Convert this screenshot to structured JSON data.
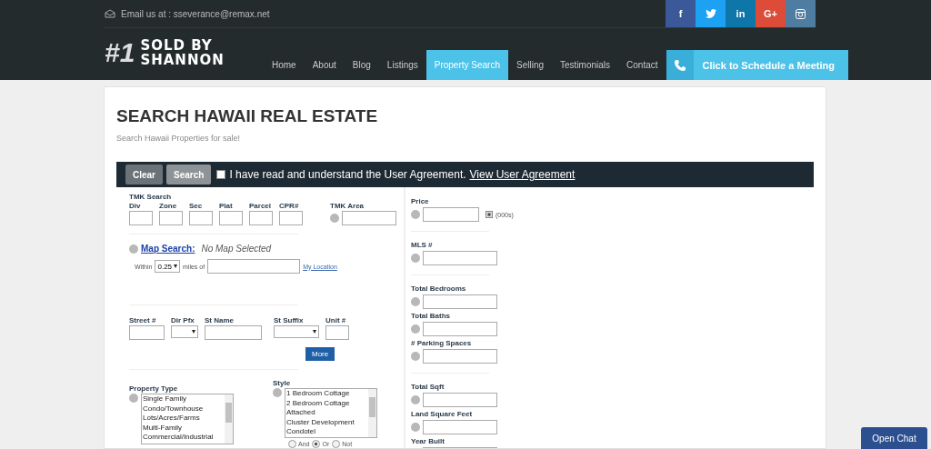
{
  "header": {
    "email": "Email us at : sseverance@remax.net",
    "social": [
      {
        "kind": "glyph",
        "label": "f",
        "color": "#3b5998"
      },
      {
        "kind": "bird",
        "color": "#1da1f2"
      },
      {
        "kind": "glyph",
        "label": "in",
        "color": "#0e76a8"
      },
      {
        "kind": "glyph",
        "label": "G+",
        "color": "#dd4b39"
      },
      {
        "kind": "camera",
        "color": "#4f7ca1"
      }
    ],
    "logo": {
      "badge": "#1",
      "line1": "SOLD BY",
      "line2": "SHANNON"
    },
    "nav": [
      {
        "label": "Home",
        "selected": false
      },
      {
        "label": "About",
        "selected": false
      },
      {
        "label": "Blog",
        "selected": false
      },
      {
        "label": "Listings",
        "selected": false
      },
      {
        "label": "Property Search",
        "selected": true
      },
      {
        "label": "Selling",
        "selected": false
      },
      {
        "label": "Testimonials",
        "selected": false
      },
      {
        "label": "Contact",
        "selected": false
      }
    ],
    "cta": "Click to Schedule a Meeting"
  },
  "title": "SEARCH HAWAII REAL ESTATE",
  "subtitle": "Search Hawaii Properties for sale!",
  "toolbar": {
    "buttons": [
      "Clear",
      "Search"
    ],
    "agree_checked": false,
    "agree_text": "I have read and understand the User Agreement.",
    "agree_link": "View User Agreement"
  },
  "tmk": {
    "heading": "TMK Search",
    "fields": [
      "Div",
      "Zone",
      "Sec",
      "Plat",
      "Parcel",
      "CPR#"
    ],
    "area_label": "TMK Area"
  },
  "map": {
    "link": "Map Search:",
    "status": "No Map Selected",
    "within": "Within",
    "radius": "0.25",
    "miles_of": "miles of",
    "location_link": "My Location"
  },
  "address": {
    "fields": [
      {
        "label": "Street #",
        "kind": "input"
      },
      {
        "label": "Dir Pfx",
        "kind": "select"
      },
      {
        "label": "St Name",
        "kind": "input"
      },
      {
        "label": "St Suffix",
        "kind": "select"
      },
      {
        "label": "Unit #",
        "kind": "input"
      }
    ],
    "more": "More"
  },
  "property_type": {
    "label": "Property Type",
    "options": [
      "Single Family",
      "Condo/Townhouse",
      "Lots/Acres/Farms",
      "Multi-Family",
      "Commercial/Industrial"
    ]
  },
  "style": {
    "label": "Style",
    "options": [
      "1 Bedroom Cottage",
      "2 Bedroom Cottage",
      "Attached",
      "Cluster Development",
      "Condotel"
    ],
    "modes": [
      {
        "label": "And",
        "selected": false
      },
      {
        "label": "Or",
        "selected": true
      },
      {
        "label": "Not",
        "selected": false
      }
    ]
  },
  "right_groups": [
    [
      {
        "label": "Price",
        "kind": "price",
        "checked": true,
        "unit": "(000s)"
      }
    ],
    [
      {
        "label": "MLS #",
        "kind": "input"
      }
    ],
    [
      {
        "label": "Total Bedrooms",
        "kind": "input"
      },
      {
        "label": "Total Baths",
        "kind": "input"
      },
      {
        "label": "# Parking Spaces",
        "kind": "input"
      }
    ],
    [
      {
        "label": "Total Sqft",
        "kind": "input"
      },
      {
        "label": "Land Square Feet",
        "kind": "input"
      },
      {
        "label": "Year Built",
        "kind": "input"
      }
    ]
  ],
  "chat": "Open Chat"
}
